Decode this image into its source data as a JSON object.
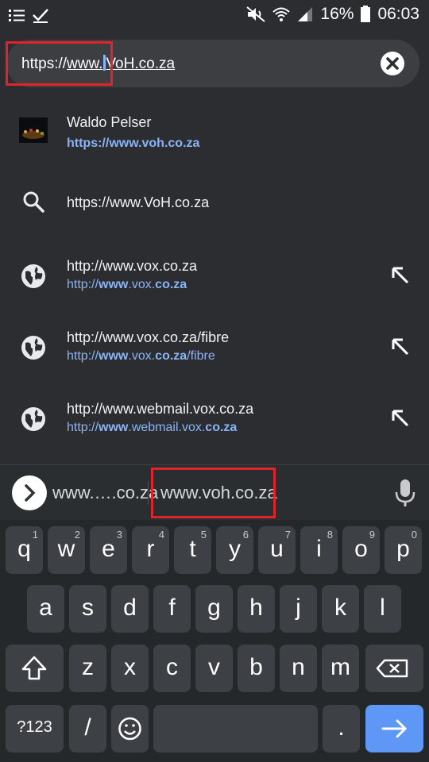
{
  "status_bar": {
    "battery": "16%",
    "time": "06:03"
  },
  "omnibox": {
    "text_prefix": "https://",
    "text_underlined_a": "www.",
    "text_underlined_b": "VoH.co.za"
  },
  "suggestions": [
    {
      "title": "Waldo Pelser",
      "url_parts": [
        {
          "t": "https://www.voh.co.za",
          "b": true
        }
      ],
      "icon": "bookmark-thumbnail"
    },
    {
      "title": "https://www.VoH.co.za",
      "url_parts": [],
      "icon": "search-icon"
    },
    {
      "title": "http://www.vox.co.za",
      "url_parts": [
        {
          "t": "http://",
          "b": false
        },
        {
          "t": "www",
          "b": true
        },
        {
          "t": ".vox.",
          "b": false
        },
        {
          "t": "co.za",
          "b": true
        }
      ],
      "icon": "globe-icon"
    },
    {
      "title": "http://www.vox.co.za/fibre",
      "url_parts": [
        {
          "t": "http://",
          "b": false
        },
        {
          "t": "www",
          "b": true
        },
        {
          "t": ".vox.",
          "b": false
        },
        {
          "t": "co.za",
          "b": true
        },
        {
          "t": "/fibre",
          "b": false
        }
      ],
      "icon": "globe-icon"
    },
    {
      "title": "http://www.webmail.vox.co.za",
      "url_parts": [
        {
          "t": "http://",
          "b": false
        },
        {
          "t": "www",
          "b": true
        },
        {
          "t": ".webmail.vox.",
          "b": false
        },
        {
          "t": "co.za",
          "b": true
        }
      ],
      "icon": "globe-icon"
    }
  ],
  "keyboard_suggestions": {
    "first": "www.….co.za",
    "second": "www.voh.co.za"
  },
  "keyboard": {
    "row1": [
      {
        "k": "q",
        "n": "1"
      },
      {
        "k": "w",
        "n": "2"
      },
      {
        "k": "e",
        "n": "3"
      },
      {
        "k": "r",
        "n": "4"
      },
      {
        "k": "t",
        "n": "5"
      },
      {
        "k": "y",
        "n": "6"
      },
      {
        "k": "u",
        "n": "7"
      },
      {
        "k": "i",
        "n": "8"
      },
      {
        "k": "o",
        "n": "9"
      },
      {
        "k": "p",
        "n": "0"
      }
    ],
    "row2": [
      "a",
      "s",
      "d",
      "f",
      "g",
      "h",
      "j",
      "k",
      "l"
    ],
    "row3": [
      "z",
      "x",
      "c",
      "v",
      "b",
      "n",
      "m"
    ],
    "symbols_label": "?123",
    "slash_label": "/",
    "period_label": "."
  },
  "colors": {
    "highlight_box": "#e0232d",
    "link": "#8ab4f8",
    "enter_key": "#5e97f6"
  }
}
